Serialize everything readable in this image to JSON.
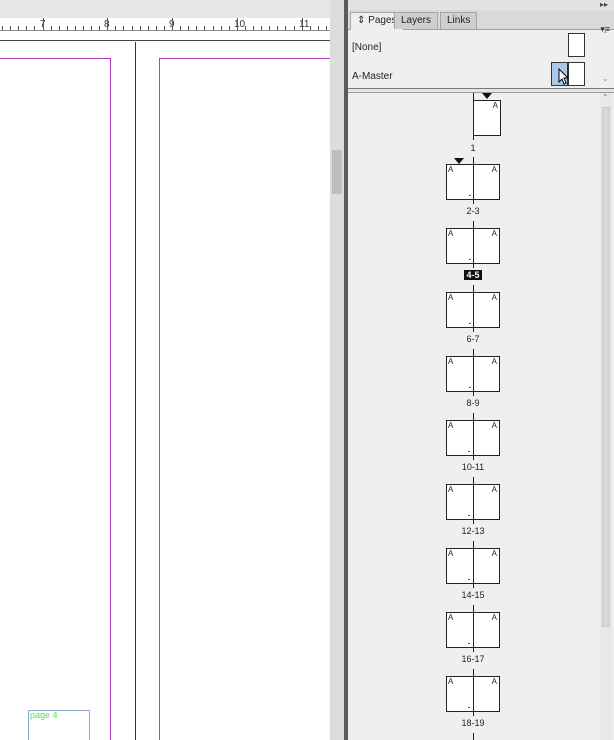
{
  "ruler": {
    "numbers": [
      "7",
      "8",
      "9",
      "10",
      "11"
    ]
  },
  "canvas": {
    "page_label": "page 4"
  },
  "panel": {
    "tabs": [
      {
        "label": "Pages",
        "active": true
      },
      {
        "label": "Layers",
        "active": false
      },
      {
        "label": "Links",
        "active": false
      }
    ],
    "masters": [
      {
        "label": "[None]"
      },
      {
        "label": "A-Master"
      }
    ],
    "pages": [
      {
        "label": "1",
        "selected": false
      },
      {
        "label": "2-3",
        "selected": false
      },
      {
        "label": "4-5",
        "selected": true
      },
      {
        "label": "6-7",
        "selected": false
      },
      {
        "label": "8-9",
        "selected": false
      },
      {
        "label": "10-11",
        "selected": false
      },
      {
        "label": "12-13",
        "selected": false
      },
      {
        "label": "14-15",
        "selected": false
      },
      {
        "label": "16-17",
        "selected": false
      },
      {
        "label": "18-19",
        "selected": false
      }
    ],
    "master_prefix": "A",
    "colors": {
      "margin": "#b43dbf",
      "selection": "#a9c8ea",
      "label_text": "#5adf4a"
    },
    "icons": [
      "panel-collapse-icon",
      "panel-menu-icon",
      "tab-arrows-icon",
      "cursor-icon",
      "start-section-icon"
    ]
  }
}
